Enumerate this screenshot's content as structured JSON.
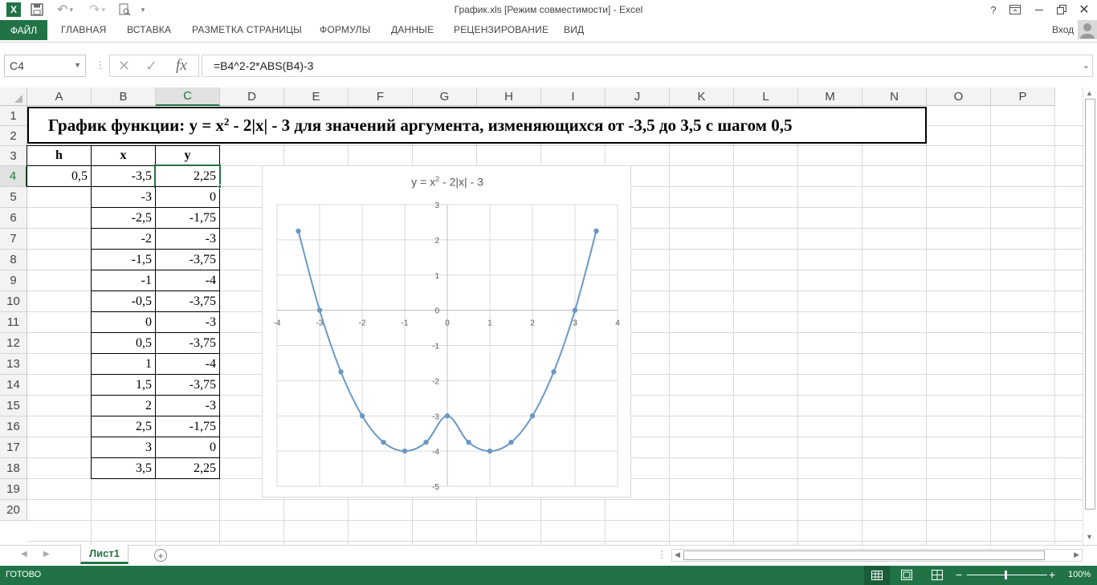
{
  "window": {
    "title": "График.xls  [Режим совместимости] - Excel",
    "user": "Вход"
  },
  "ribbon": {
    "tabs": [
      "ФАЙЛ",
      "ГЛАВНАЯ",
      "ВСТАВКА",
      "РАЗМЕТКА СТРАНИЦЫ",
      "ФОРМУЛЫ",
      "ДАННЫЕ",
      "РЕЦЕНЗИРОВАНИЕ",
      "ВИД"
    ]
  },
  "formula_bar": {
    "name_box": "C4",
    "formula": "=B4^2-2*ABS(B4)-3",
    "fx_label": "fx"
  },
  "columns": [
    "A",
    "B",
    "C",
    "D",
    "E",
    "F",
    "G",
    "H",
    "I",
    "J",
    "K",
    "L",
    "M",
    "N",
    "O",
    "P"
  ],
  "rows": [
    "1",
    "2",
    "3",
    "4",
    "5",
    "6",
    "7",
    "8",
    "9",
    "10",
    "11",
    "12",
    "13",
    "14",
    "15",
    "16",
    "17",
    "18",
    "19",
    "20"
  ],
  "sheet": {
    "title_prefix": "График функции: y = x",
    "title_sup": "2",
    "title_suffix": " - 2|x| - 3 для значений аргумента, изменяющихся от -3,5 до 3,5 с шагом 0,5",
    "headers": {
      "h": "h",
      "x": "x",
      "y": "y"
    },
    "h_value": "0,5",
    "x_values": [
      "-3,5",
      "-3",
      "-2,5",
      "-2",
      "-1,5",
      "-1",
      "-0,5",
      "0",
      "0,5",
      "1",
      "1,5",
      "2",
      "2,5",
      "3",
      "3,5"
    ],
    "y_values": [
      "2,25",
      "0",
      "-1,75",
      "-3",
      "-3,75",
      "-4",
      "-3,75",
      "-3",
      "-3,75",
      "-4",
      "-3,75",
      "-3",
      "-1,75",
      "0",
      "2,25"
    ]
  },
  "chart_data": {
    "type": "scatter",
    "title_prefix": "y = x",
    "title_sup": "2",
    "title_suffix": " - 2|x| - 3",
    "x": [
      -3.5,
      -3,
      -2.5,
      -2,
      -1.5,
      -1,
      -0.5,
      0,
      0.5,
      1,
      1.5,
      2,
      2.5,
      3,
      3.5
    ],
    "y": [
      2.25,
      0,
      -1.75,
      -3,
      -3.75,
      -4,
      -3.75,
      -3,
      -3.75,
      -4,
      -3.75,
      -3,
      -1.75,
      0,
      2.25
    ],
    "xlim": [
      -4,
      4
    ],
    "ylim": [
      -5,
      3
    ],
    "x_ticks": [
      "-4",
      "-3",
      "-2",
      "-1",
      "0",
      "1",
      "2",
      "3",
      "4"
    ],
    "y_ticks": [
      "3",
      "2",
      "1",
      "0",
      "-1",
      "-2",
      "-3",
      "-4",
      "-5"
    ],
    "grid": true,
    "smooth": true,
    "color": "#6a98c5"
  },
  "sheet_tabs": {
    "active": "Лист1"
  },
  "status": {
    "ready": "ГОТОВО",
    "zoom": "100%"
  },
  "colors": {
    "accent": "#217346",
    "selection": "#217346"
  }
}
